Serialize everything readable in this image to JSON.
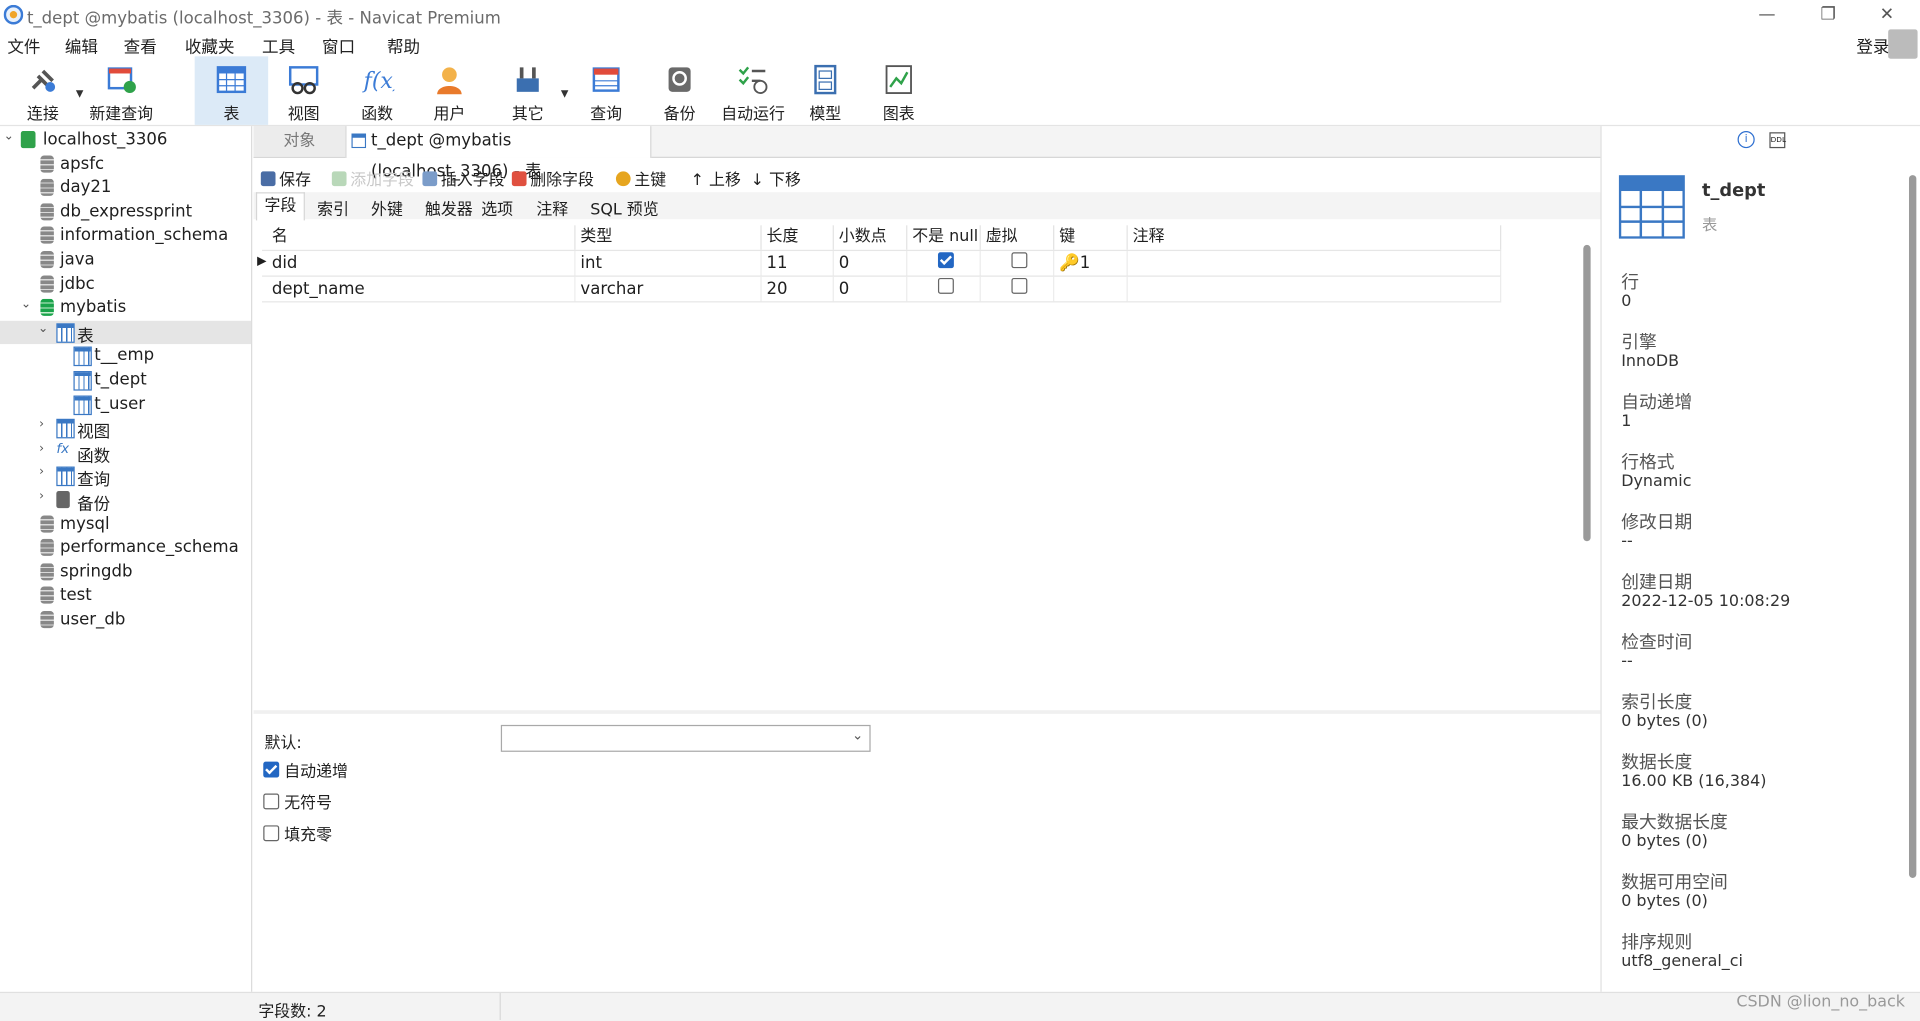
{
  "window": {
    "title": "t_dept @mybatis (localhost_3306) - 表 - Navicat Premium",
    "minimize": "—",
    "restore": "❐",
    "close": "✕"
  },
  "menu": [
    "文件",
    "编辑",
    "查看",
    "收藏夹",
    "工具",
    "窗口",
    "帮助"
  ],
  "login": "登录",
  "toolbar": {
    "connect": "连接",
    "new_query": "新建查询",
    "table": "表",
    "view": "视图",
    "function": "函数",
    "user": "用户",
    "other": "其它",
    "query": "查询",
    "backup": "备份",
    "auto_run": "自动运行",
    "model": "模型",
    "chart": "图表"
  },
  "tree": {
    "connection": "localhost_3306",
    "databases": [
      "apsfc",
      "day21",
      "db_expressprint",
      "information_schema",
      "java",
      "jdbc"
    ],
    "open_db": "mybatis",
    "tables_node": "表",
    "tables": [
      "t__emp",
      "t_dept",
      "t_user"
    ],
    "groups": [
      "视图",
      "函数",
      "查询",
      "备份"
    ],
    "more_databases": [
      "mysql",
      "performance_schema",
      "springdb",
      "test",
      "user_db"
    ]
  },
  "tabs": {
    "objects": "对象",
    "doc": "t_dept @mybatis (localhost_3306) - 表"
  },
  "doc_toolbar": {
    "save": "保存",
    "add_field": "添加字段",
    "insert_field": "插入字段",
    "delete_field": "删除字段",
    "primary_key": "主键",
    "move_up": "上移",
    "move_down": "下移"
  },
  "subtabs": [
    "字段",
    "索引",
    "外键",
    "触发器",
    "选项",
    "注释",
    "SQL 预览"
  ],
  "grid": {
    "headers": [
      "名",
      "类型",
      "长度",
      "小数点",
      "不是 null",
      "虚拟",
      "键",
      "注释"
    ],
    "rows": [
      {
        "name": "did",
        "type": "int",
        "length": "11",
        "decimals": "0",
        "not_null": true,
        "virtual": false,
        "key": "1"
      },
      {
        "name": "dept_name",
        "type": "varchar",
        "length": "20",
        "decimals": "0",
        "not_null": false,
        "virtual": false,
        "key": ""
      }
    ]
  },
  "options": {
    "default_label": "默认:",
    "auto_increment": "自动递增",
    "unsigned": "无符号",
    "zerofill": "填充零"
  },
  "info": {
    "name": "t_dept",
    "kind": "表",
    "items": [
      {
        "label": "行",
        "value": "0"
      },
      {
        "label": "引擎",
        "value": "InnoDB"
      },
      {
        "label": "自动递增",
        "value": "1"
      },
      {
        "label": "行格式",
        "value": "Dynamic"
      },
      {
        "label": "修改日期",
        "value": "--"
      },
      {
        "label": "创建日期",
        "value": "2022-12-05 10:08:29"
      },
      {
        "label": "检查时间",
        "value": "--"
      },
      {
        "label": "索引长度",
        "value": "0 bytes (0)"
      },
      {
        "label": "数据长度",
        "value": "16.00 KB (16,384)"
      },
      {
        "label": "最大数据长度",
        "value": "0 bytes (0)"
      },
      {
        "label": "数据可用空间",
        "value": "0 bytes (0)"
      },
      {
        "label": "排序规则",
        "value": "utf8_general_ci"
      }
    ]
  },
  "status": {
    "field_count": "字段数: 2",
    "watermark": "CSDN @lion_no_back"
  }
}
